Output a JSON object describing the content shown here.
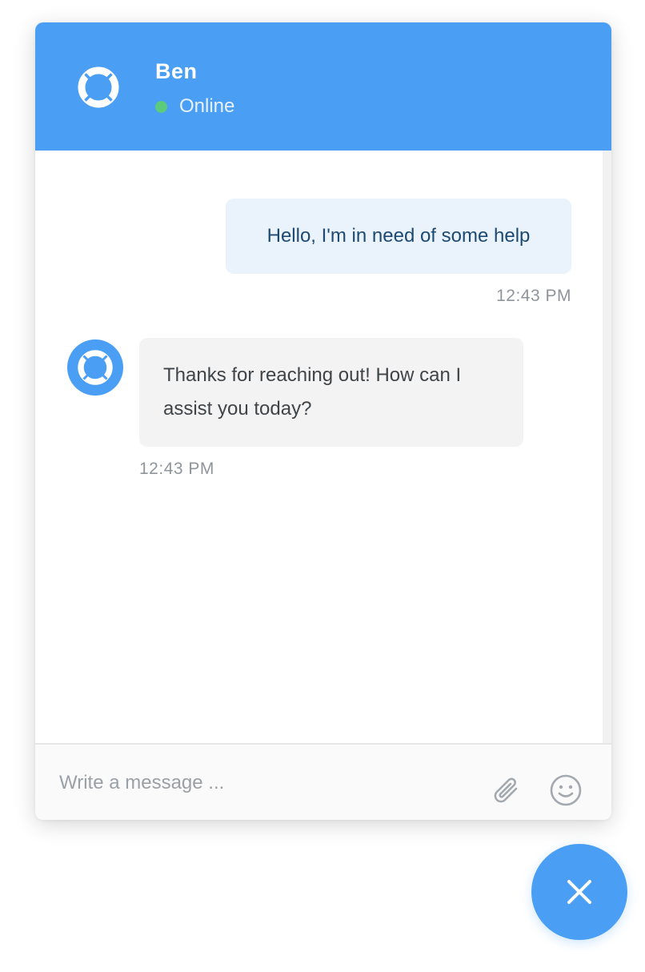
{
  "header": {
    "agent_name": "Ben",
    "status": "Online",
    "avatar_icon": "lifebuoy-icon",
    "background_color": "#4a9ff5",
    "status_color": "#5ccb7e"
  },
  "messages": [
    {
      "sender": "user",
      "text": "Hello, I'm in need of some help",
      "time": "12:43 PM"
    },
    {
      "sender": "agent",
      "avatar_icon": "lifebuoy-icon",
      "text": "Thanks for reaching out! How can I assist you today?",
      "time": "12:43 PM"
    }
  ],
  "composer": {
    "placeholder": "Write a message ...",
    "value": "",
    "attach_icon": "paperclip-icon",
    "emoji_icon": "smiley-icon"
  },
  "launcher": {
    "icon": "close-icon",
    "color": "#4a9ff5"
  }
}
